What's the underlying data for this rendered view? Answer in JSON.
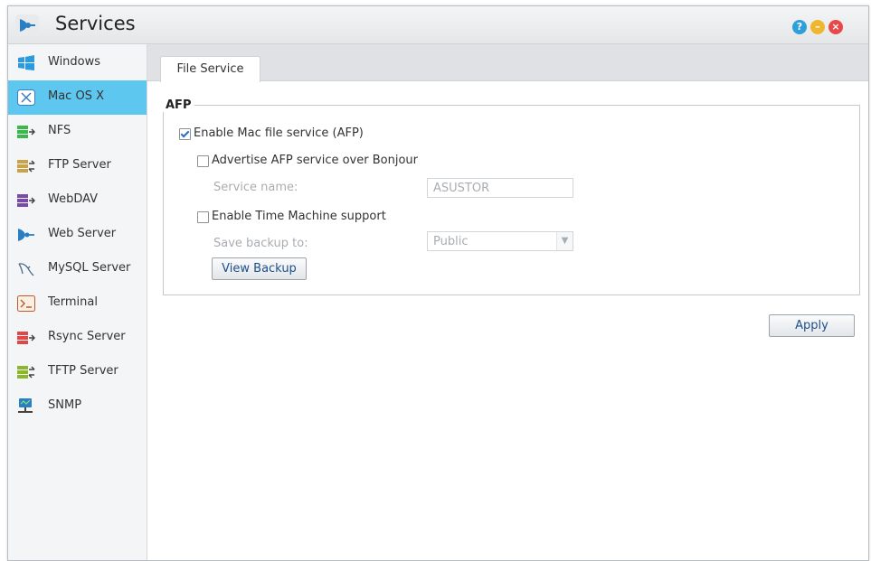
{
  "window": {
    "title": "Services"
  },
  "sidebar": {
    "items": [
      {
        "label": "Windows"
      },
      {
        "label": "Mac OS X"
      },
      {
        "label": "NFS"
      },
      {
        "label": "FTP Server"
      },
      {
        "label": "WebDAV"
      },
      {
        "label": "Web Server"
      },
      {
        "label": "MySQL Server"
      },
      {
        "label": "Terminal"
      },
      {
        "label": "Rsync Server"
      },
      {
        "label": "TFTP Server"
      },
      {
        "label": "SNMP"
      }
    ],
    "active_index": 1
  },
  "tabs": [
    {
      "label": "File Service"
    }
  ],
  "afp": {
    "legend": "AFP",
    "enable_label": "Enable Mac file service (AFP)",
    "enable_checked": true,
    "bonjour_label": "Advertise AFP service over Bonjour",
    "bonjour_checked": false,
    "service_name_label": "Service name:",
    "service_name_value": "ASUSTOR",
    "time_machine_label": "Enable Time Machine support",
    "time_machine_checked": false,
    "save_backup_label": "Save backup to:",
    "save_backup_value": "Public",
    "view_backup_label": "View Backup"
  },
  "apply_label": "Apply",
  "colors": {
    "accent": "#5ec7ef",
    "help": "#2e9fd8",
    "minimize": "#f0b630",
    "close": "#e94848"
  }
}
